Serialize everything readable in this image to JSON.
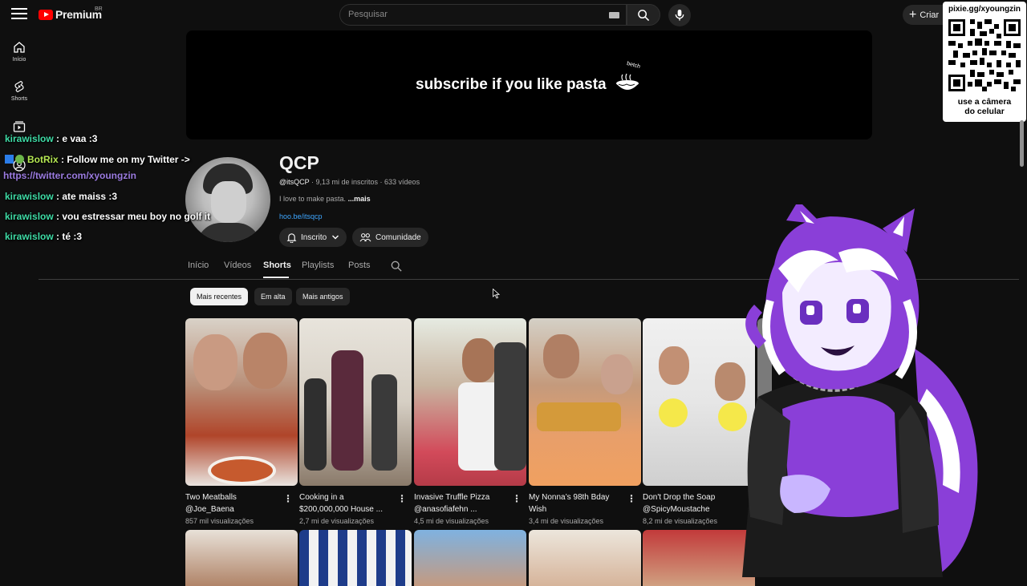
{
  "header": {
    "logo_text": "Premium",
    "logo_country": "BR",
    "search_placeholder": "Pesquisar",
    "create_label": "Criar"
  },
  "sidebar": {
    "items": [
      {
        "label": "Início",
        "icon": "home-icon"
      },
      {
        "label": "Shorts",
        "icon": "shorts-icon"
      },
      {
        "label": "",
        "icon": "subscriptions-icon"
      },
      {
        "label": "",
        "icon": "account-icon"
      }
    ]
  },
  "banner": {
    "text": "subscribe if you like pasta",
    "signature": "betch"
  },
  "channel": {
    "name": "QCP",
    "handle": "@itsQCP",
    "subscribers": "9,13 mi de inscritos",
    "videos": "633 vídeos",
    "sep": " · ",
    "description": "I love to make pasta.",
    "more": "...mais",
    "link": "hoo.be/itsqcp",
    "subscribed_label": "Inscrito",
    "community_label": "Comunidade"
  },
  "tabs": [
    "Início",
    "Vídeos",
    "Shorts",
    "Playlists",
    "Posts"
  ],
  "active_tab": "Shorts",
  "chips": [
    "Mais recentes",
    "Em alta",
    "Mais antigos"
  ],
  "shorts": [
    {
      "title": "Two Meatballs @Joe_Baena",
      "views": "857 mil visualizações"
    },
    {
      "title": "Cooking in a $200,000,000 House ...",
      "views": "2,7 mi de visualizações"
    },
    {
      "title": "Invasive Truffle Pizza @anasofiafehn ...",
      "views": "4,5 mi de visualizações"
    },
    {
      "title": "My Nonna’s 98th Bday Wish",
      "views": "3,4 mi de visualizações"
    },
    {
      "title": "Don't Drop the Soap @SpicyMoustache",
      "views": "8,2 mi de visualizações"
    }
  ],
  "chat": [
    {
      "user": "kirawislow",
      "message": ": e vaa :3"
    },
    {
      "user": "BotRix",
      "message": ": Follow me on my Twitter ->"
    },
    {
      "user": "",
      "message": "https://twitter.com/xyoungzin"
    },
    {
      "user": "kirawislow",
      "message": ": ate maiss :3"
    },
    {
      "user": "kirawislow",
      "message": ": vou estressar meu boy no golf it"
    },
    {
      "user": "kirawislow",
      "message": ": té :3"
    }
  ],
  "qr": {
    "url": "pixie.gg/xyoungzin",
    "caption_line1": "use a câmera",
    "caption_line2": "do celular"
  },
  "colors": {
    "background": "#0f0f0f",
    "brand_red": "#ff0000",
    "link_blue": "#3ea6ff",
    "chat_user": "#3fdca6",
    "chat_bot": "#b5e853",
    "chat_link": "#9b7be0",
    "vtuber_purple": "#8a3fd8"
  }
}
